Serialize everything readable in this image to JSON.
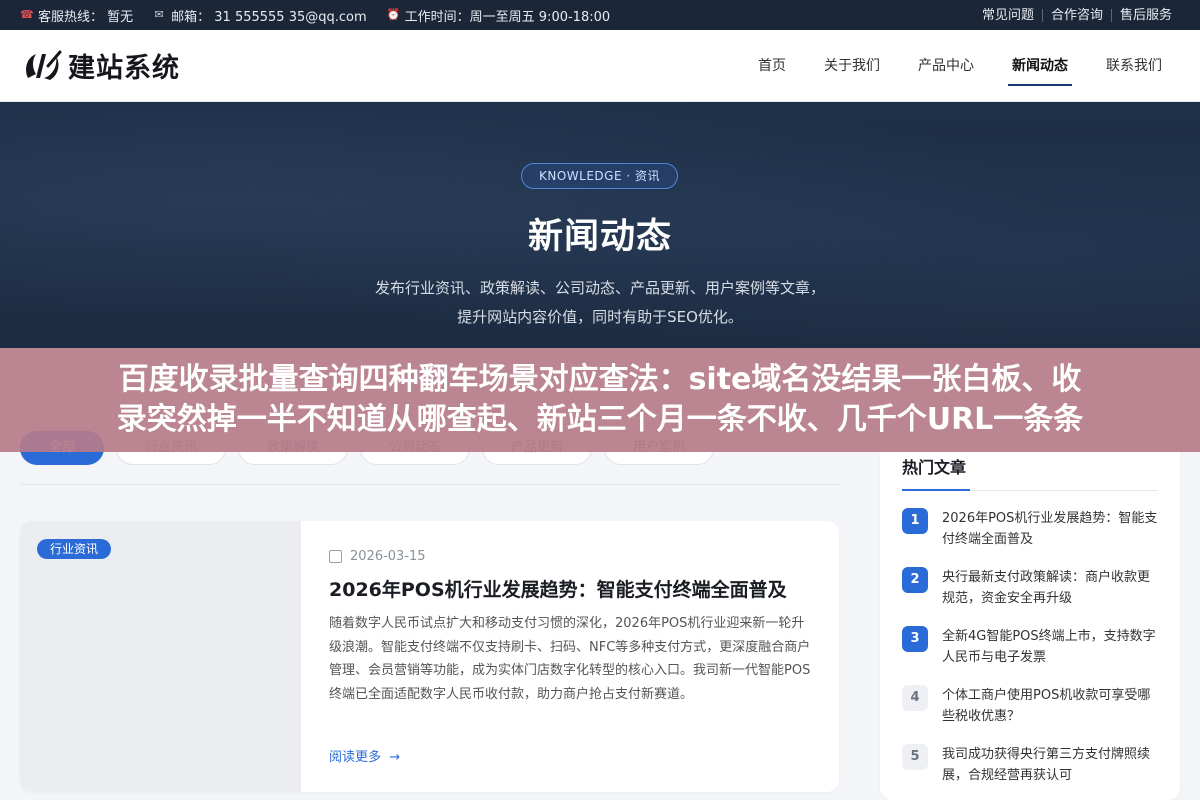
{
  "topbar": {
    "hotline": "客服热线：  暂无",
    "email": "邮箱：  31 555555 35@qq.com",
    "hours": "工作时间：周一至周五 9:00-18:00",
    "links": [
      "常见问题",
      "合作咨询",
      "售后服务"
    ],
    "icons": [
      "phone-icon",
      "mail-icon",
      "clock-icon"
    ],
    "accent_phone": "#e05050"
  },
  "header": {
    "logo_text": "建站系统",
    "nav": [
      "首页",
      "关于我们",
      "产品中心",
      "新闻动态",
      "联系我们"
    ],
    "active_nav": "新闻动态"
  },
  "hero": {
    "pill": "KNOWLEDGE · 资讯",
    "title": "新闻动态",
    "desc_line1": "发布行业资讯、政策解读、公司动态、产品更新、用户案例等文章，",
    "desc_line2": "提升网站内容价值，同时有助于SEO优化。",
    "bg_color": "#1e2f48"
  },
  "banner": {
    "line1": "百度收录批量查询四种翻车场景对应查法：site域名没结果一张白板、收",
    "line2": "录突然掉一半不知道从哪查起、新站三个月一条不收、几千个URL一条条",
    "bg_color": "#b67c8a"
  },
  "filters": {
    "items": [
      "全部",
      "行业资讯",
      "政策解读",
      "公司动态",
      "产品更新",
      "用户案例"
    ],
    "active": "全部",
    "accent": "#2a6bd8"
  },
  "article": {
    "tag": "行业资讯",
    "date": "2026-03-15",
    "title": "2026年POS机行业发展趋势：智能支付终端全面普及",
    "excerpt": "随着数字人民币试点扩大和移动支付习惯的深化，2026年POS机行业迎来新一轮升级浪潮。智能支付终端不仅支持刷卡、扫码、NFC等多种支付方式，更深度融合商户管理、会员营销等功能，成为实体门店数字化转型的核心入口。我司新一代智能POS终端已全面适配数字人民币收付款，助力商户抢占支付新赛道。",
    "read_more": "阅读更多"
  },
  "sidebar": {
    "heading": "热门文章",
    "items": [
      {
        "num": "1",
        "title": "2026年POS机行业发展趋势：智能支付终端全面普及"
      },
      {
        "num": "2",
        "title": "央行最新支付政策解读：商户收款更规范，资金安全再升级"
      },
      {
        "num": "3",
        "title": "全新4G智能POS终端上市，支持数字人民币与电子发票"
      },
      {
        "num": "4",
        "title": "个体工商户使用POS机收款可享受哪些税收优惠？"
      },
      {
        "num": "5",
        "title": "我司成功获得央行第三方支付牌照续展，合规经营再获认可"
      }
    ]
  }
}
